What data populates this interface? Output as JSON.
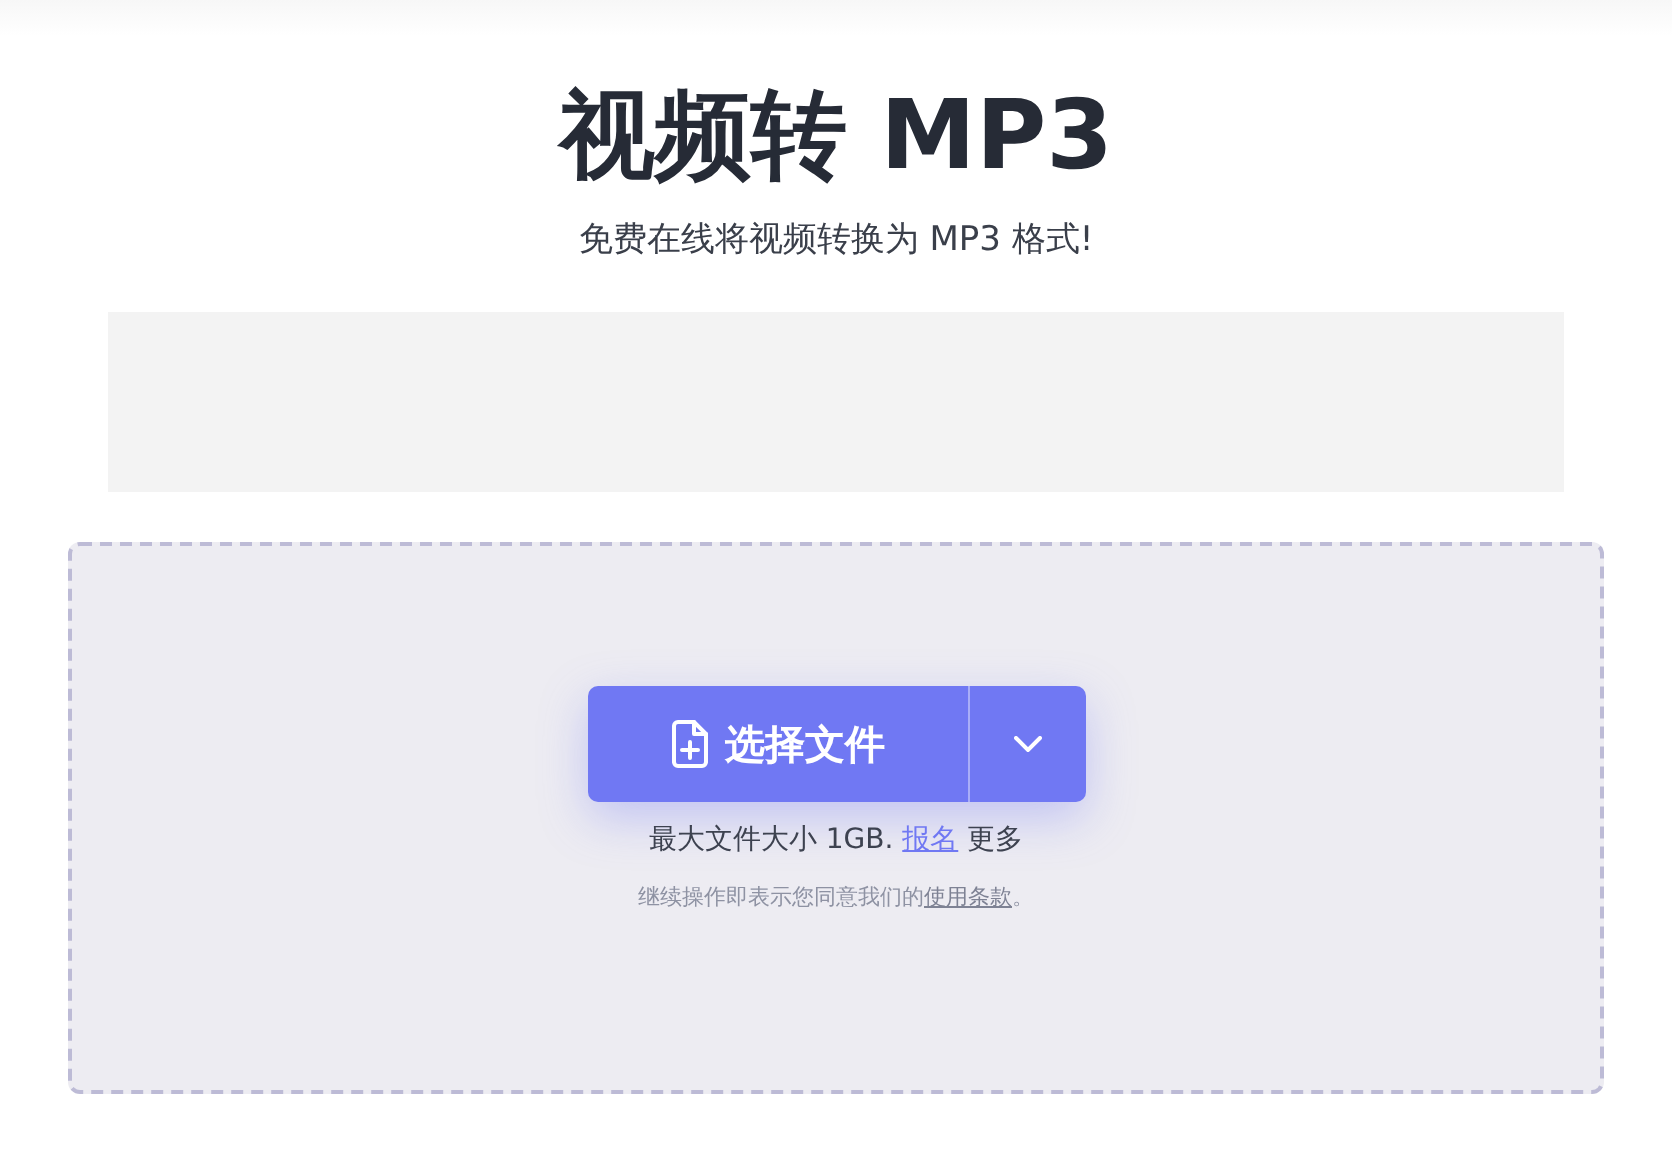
{
  "title": "视频转 MP3",
  "subtitle": "免费在线将视频转换为 MP3 格式!",
  "upload": {
    "button": "选择文件",
    "size_note": {
      "before": "最大文件大小 1GB. ",
      "link": "报名",
      "after": " 更多"
    },
    "terms_note": {
      "before": "继续操作即表示您同意我们的",
      "link": "使用条款",
      "after": "。"
    }
  }
}
